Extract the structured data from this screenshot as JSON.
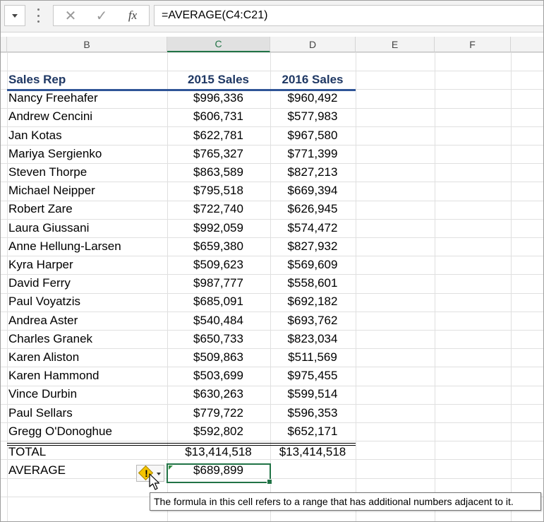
{
  "formula_bar": {
    "cancel_glyph": "✕",
    "enter_glyph": "✓",
    "fx_label": "fx",
    "formula": "=AVERAGE(C4:C21)"
  },
  "columns": [
    {
      "label": "B",
      "selected": false
    },
    {
      "label": "C",
      "selected": true
    },
    {
      "label": "D",
      "selected": false
    },
    {
      "label": "E",
      "selected": false
    },
    {
      "label": "F",
      "selected": false
    }
  ],
  "table": {
    "headers": [
      "Sales Rep",
      "2015 Sales",
      "2016 Sales"
    ],
    "rows": [
      [
        "Nancy Freehafer",
        "$996,336",
        "$960,492"
      ],
      [
        "Andrew Cencini",
        "$606,731",
        "$577,983"
      ],
      [
        "Jan Kotas",
        "$622,781",
        "$967,580"
      ],
      [
        "Mariya Sergienko",
        "$765,327",
        "$771,399"
      ],
      [
        "Steven Thorpe",
        "$863,589",
        "$827,213"
      ],
      [
        "Michael Neipper",
        "$795,518",
        "$669,394"
      ],
      [
        "Robert Zare",
        "$722,740",
        "$626,945"
      ],
      [
        "Laura Giussani",
        "$992,059",
        "$574,472"
      ],
      [
        "Anne Hellung-Larsen",
        "$659,380",
        "$827,932"
      ],
      [
        "Kyra Harper",
        "$509,623",
        "$569,609"
      ],
      [
        "David Ferry",
        "$987,777",
        "$558,601"
      ],
      [
        "Paul Voyatzis",
        "$685,091",
        "$692,182"
      ],
      [
        "Andrea Aster",
        "$540,484",
        "$693,762"
      ],
      [
        "Charles Granek",
        "$650,733",
        "$823,034"
      ],
      [
        "Karen Aliston",
        "$509,863",
        "$511,569"
      ],
      [
        "Karen Hammond",
        "$503,699",
        "$975,455"
      ],
      [
        "Vince Durbin",
        "$630,263",
        "$599,514"
      ],
      [
        "Paul Sellars",
        "$779,722",
        "$596,353"
      ],
      [
        "Gregg O'Donoghue",
        "$592,802",
        "$652,171"
      ]
    ],
    "total": [
      "TOTAL",
      "$13,414,518",
      "$13,414,518"
    ],
    "average": [
      "AVERAGE",
      "$689,899"
    ]
  },
  "smart_tag": {
    "icon": "warning-icon",
    "glyph": "!"
  },
  "tooltip": "The formula in this cell refers to a range that has additional numbers adjacent to it.",
  "colors": {
    "accent": "#217346",
    "header_text": "#1f3864",
    "header_rule": "#2f5597",
    "warning": "#f5c400"
  }
}
